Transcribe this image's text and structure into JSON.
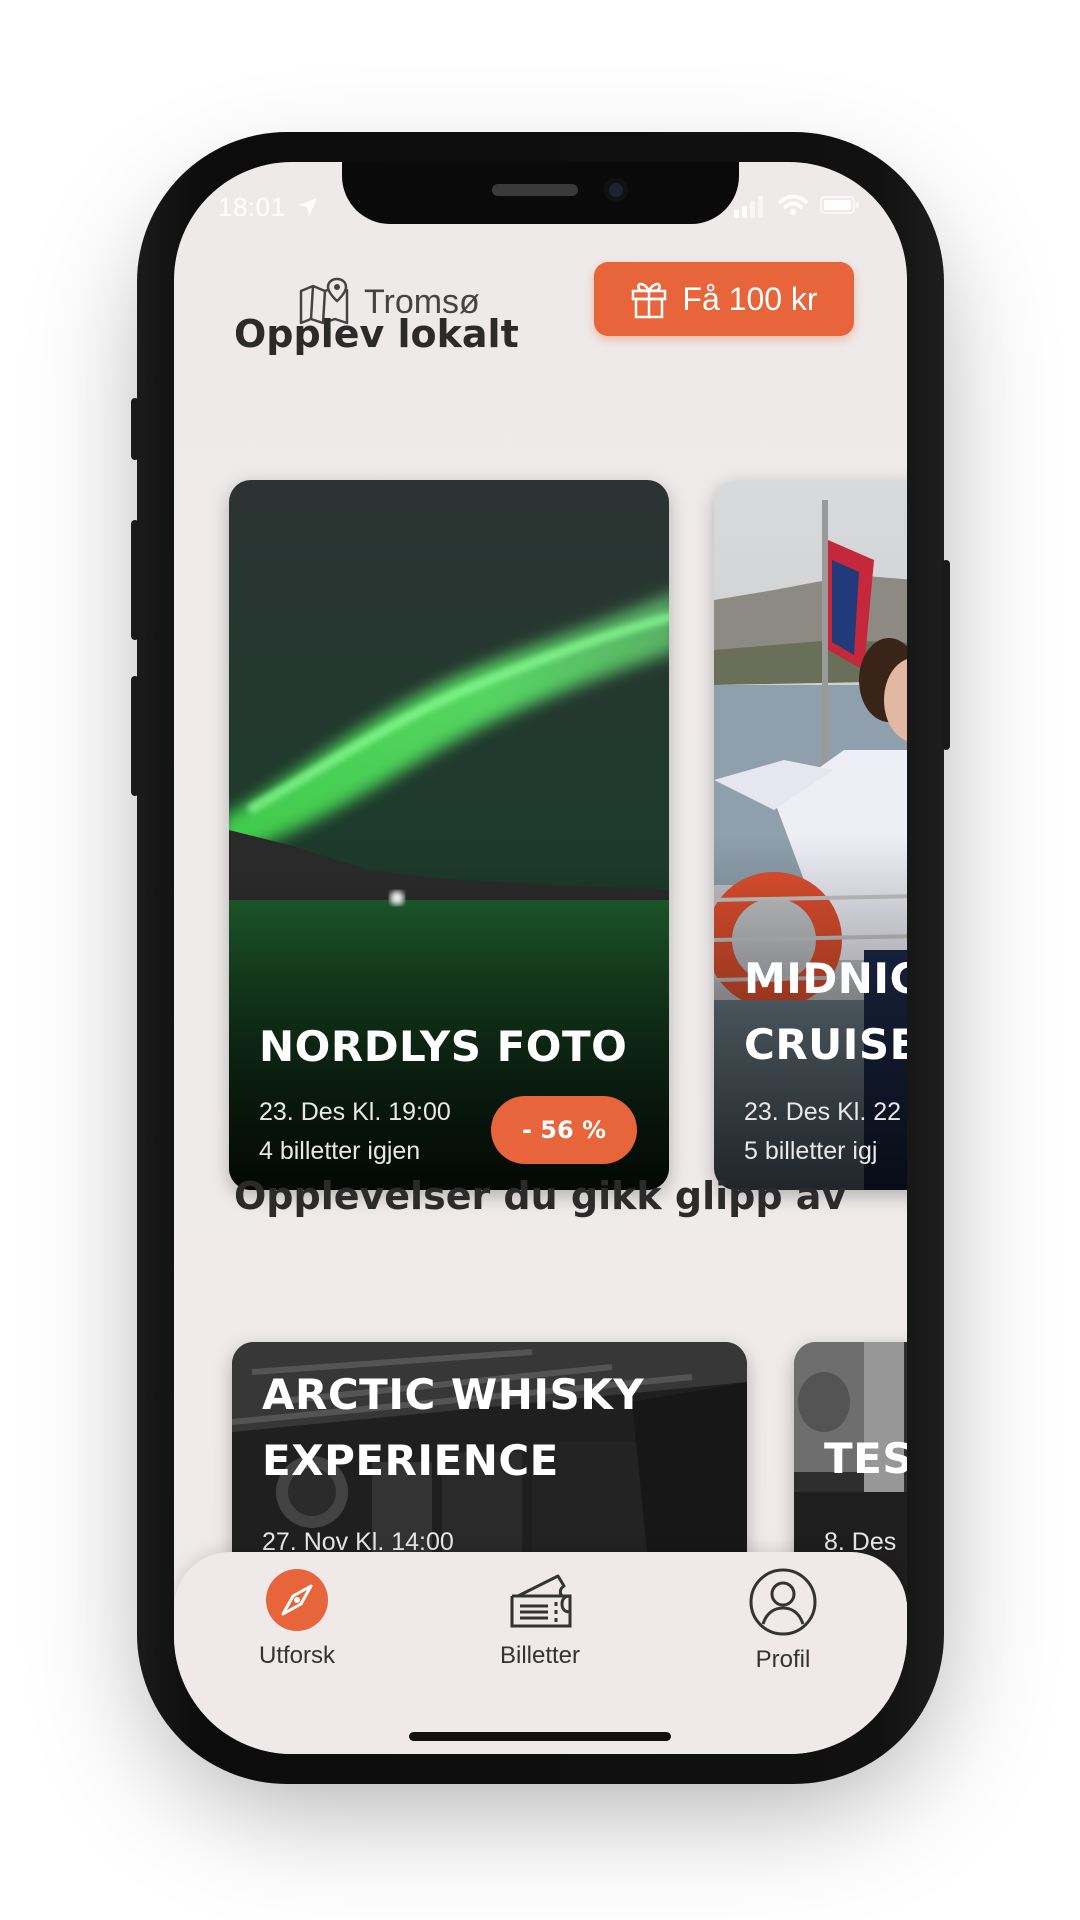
{
  "status_bar": {
    "time": "18:01"
  },
  "header": {
    "location": "Tromsø",
    "promo_label": "Få 100 kr"
  },
  "sections": {
    "local_title": "Opplev lokalt",
    "missed_title": "Opplevelser du gikk glipp av"
  },
  "local_cards": [
    {
      "title": "NORDLYS FOTO",
      "date": "23. Des Kl. 19:00",
      "tickets": "4 billetter igjen",
      "discount": "- 56 %"
    },
    {
      "title": "MIDNIG\nCRUISE",
      "date": "23. Des Kl. 22",
      "tickets": "5 billetter igj"
    }
  ],
  "missed_cards": [
    {
      "title": "ARCTIC WHISKY\nEXPERIENCE",
      "date": "27. Nov Kl. 14:00"
    },
    {
      "title": "TES",
      "date": "8. Des"
    }
  ],
  "tabs": [
    {
      "label": "Utforsk",
      "icon": "compass-icon",
      "active": true
    },
    {
      "label": "Billetter",
      "icon": "ticket-icon",
      "active": false
    },
    {
      "label": "Profil",
      "icon": "profile-icon",
      "active": false
    }
  ],
  "colors": {
    "accent": "#e8643a",
    "background": "#efeaea",
    "text": "#2b2b2b"
  }
}
